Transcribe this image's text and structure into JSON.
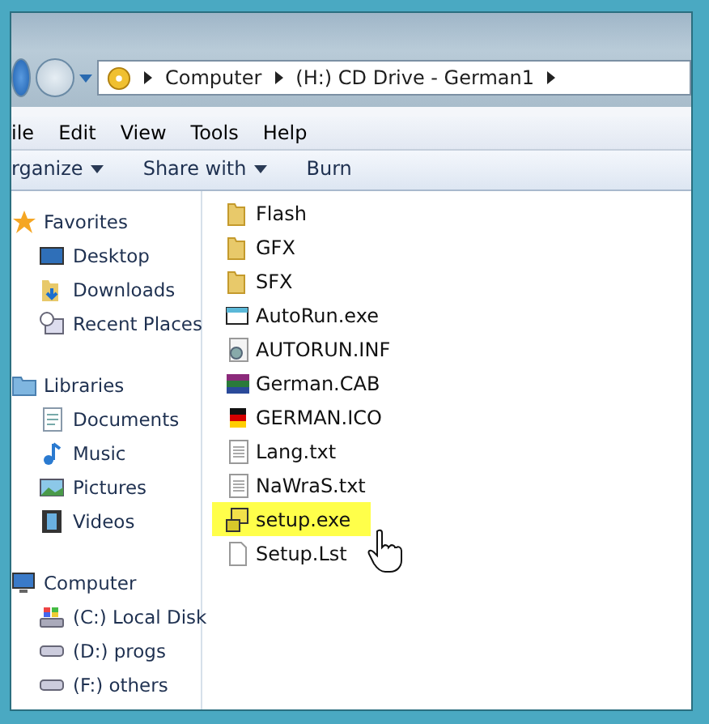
{
  "address_bar": {
    "path": [
      "Computer",
      "(H:) CD Drive - German1"
    ]
  },
  "menu_bar": [
    "ile",
    "Edit",
    "View",
    "Tools",
    "Help"
  ],
  "toolbar": [
    {
      "label": "rganize",
      "dropdown": true
    },
    {
      "label": "Share with",
      "dropdown": true
    },
    {
      "label": "Burn",
      "dropdown": false
    }
  ],
  "sidebar": {
    "groups": [
      {
        "label": "Favorites",
        "kind": "favorites",
        "children": [
          {
            "label": "Desktop",
            "kind": "desktop"
          },
          {
            "label": "Downloads",
            "kind": "downloads"
          },
          {
            "label": "Recent Places",
            "kind": "recent"
          }
        ]
      },
      {
        "label": "Libraries",
        "kind": "libraries",
        "children": [
          {
            "label": "Documents",
            "kind": "documents"
          },
          {
            "label": "Music",
            "kind": "music"
          },
          {
            "label": "Pictures",
            "kind": "pictures"
          },
          {
            "label": "Videos",
            "kind": "videos"
          }
        ]
      },
      {
        "label": "Computer",
        "kind": "computer",
        "children": [
          {
            "label": "(C:) Local Disk",
            "kind": "windisk"
          },
          {
            "label": "(D:) progs",
            "kind": "disk"
          },
          {
            "label": "(F:) others",
            "kind": "disk"
          }
        ]
      }
    ]
  },
  "files": [
    {
      "name": "Flash",
      "kind": "folder",
      "selected": false
    },
    {
      "name": "GFX",
      "kind": "folder",
      "selected": false
    },
    {
      "name": "SFX",
      "kind": "folder",
      "selected": false
    },
    {
      "name": "AutoRun.exe",
      "kind": "app",
      "selected": false
    },
    {
      "name": "AUTORUN.INF",
      "kind": "settings",
      "selected": false
    },
    {
      "name": "German.CAB",
      "kind": "archive",
      "selected": false
    },
    {
      "name": "GERMAN.ICO",
      "kind": "flag",
      "selected": false
    },
    {
      "name": "Lang.txt",
      "kind": "text",
      "selected": false
    },
    {
      "name": "NaWraS.txt",
      "kind": "text",
      "selected": false
    },
    {
      "name": "setup.exe",
      "kind": "installer",
      "selected": true
    },
    {
      "name": "Setup.Lst",
      "kind": "blank",
      "selected": false
    }
  ]
}
